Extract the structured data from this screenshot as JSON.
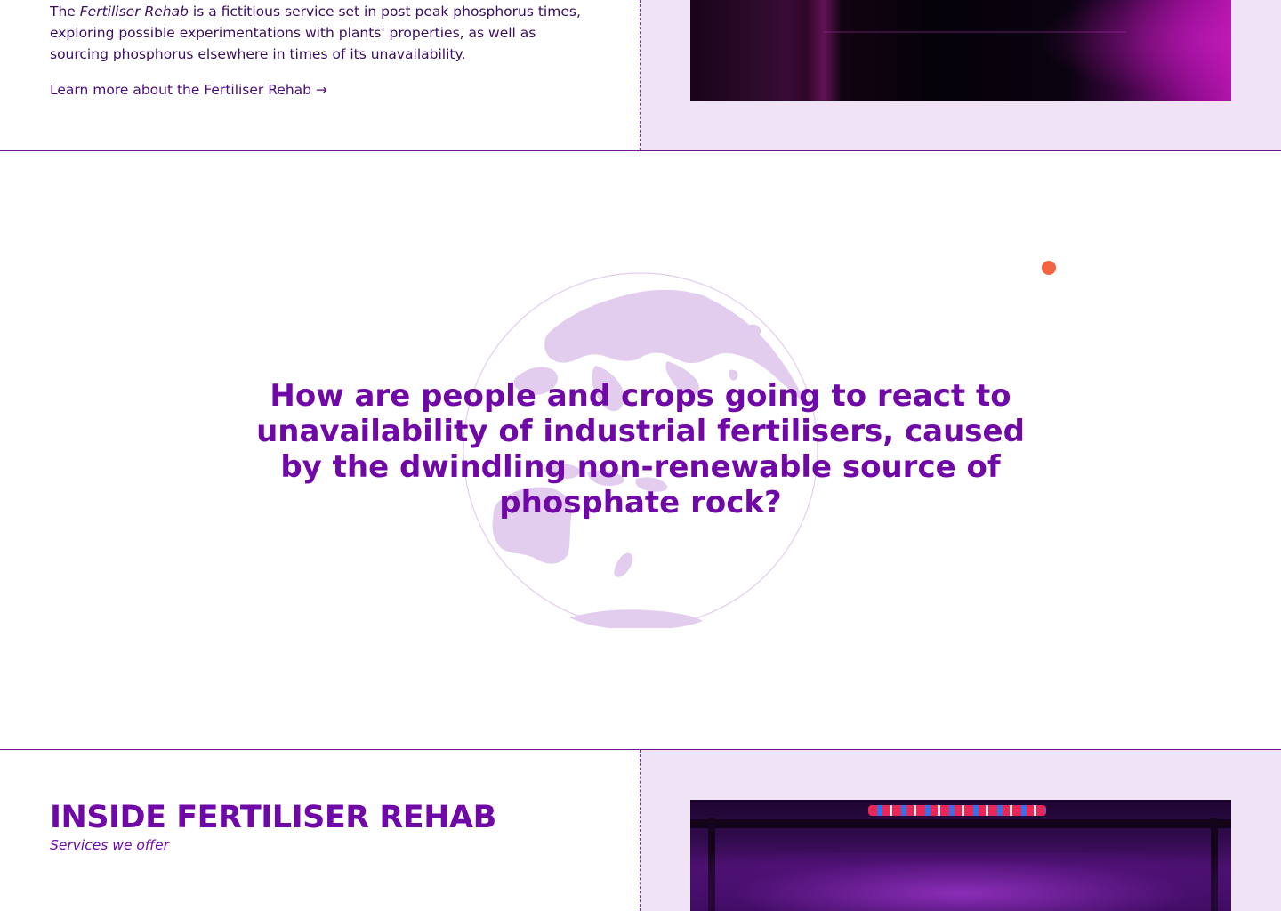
{
  "intro": {
    "prefix": "The ",
    "service_name": "Fertiliser Rehab",
    "suffix": " is a fictitious service set in post peak phosphorus times, exploring possible experimentations with plants' properties, as well as sourcing phosphorus elsewhere in times of its unavailability.",
    "link_label": "Learn more about the Fertiliser Rehab →"
  },
  "question": {
    "text": "How are people and crops going to react to unavailability of industrial fertilisers, caused by the dwindling non-renewable source of phosphate rock?"
  },
  "services": {
    "heading": "INSIDE FERTILISER REHAB",
    "subheading": "Services we offer"
  },
  "colors": {
    "accent": "#7008a8",
    "panel_bg": "#f0e3f5",
    "dot": "#f26540",
    "text": "#3a0d5e"
  }
}
